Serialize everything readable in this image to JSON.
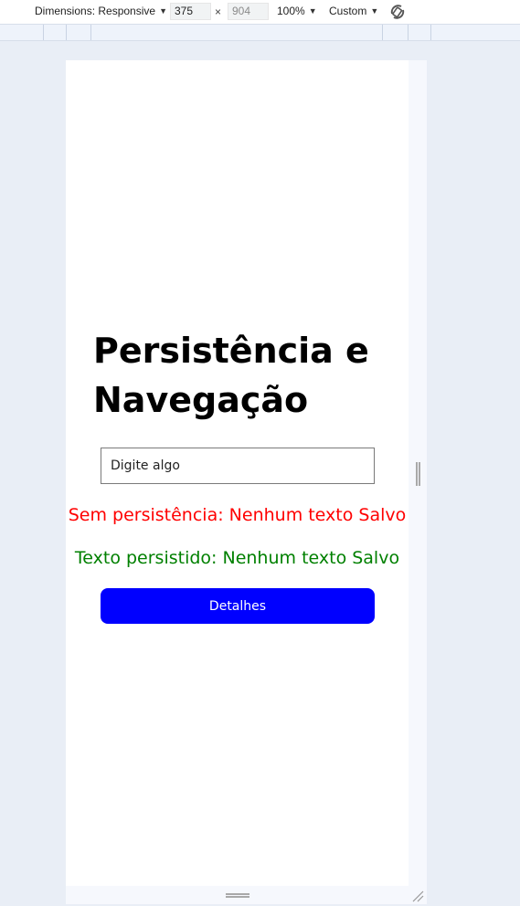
{
  "toolbar": {
    "dimensions_label": "Dimensions: Responsive",
    "width_value": "375",
    "height_placeholder": "904",
    "times": "×",
    "zoom_label": "100%",
    "throttle_label": "Custom",
    "rotate_icon": "rotate-icon"
  },
  "app": {
    "title": "Persistência e Navegação",
    "input_placeholder": "Digite algo",
    "no_persistence_text": "Sem persistência: Nenhum texto Salvo",
    "persisted_text": "Texto persistido: Nenhum texto Salvo",
    "details_button_label": "Detalhes"
  },
  "colors": {
    "no_persistence": "#ff0000",
    "persisted": "#008000",
    "button_bg": "#0000ff"
  }
}
